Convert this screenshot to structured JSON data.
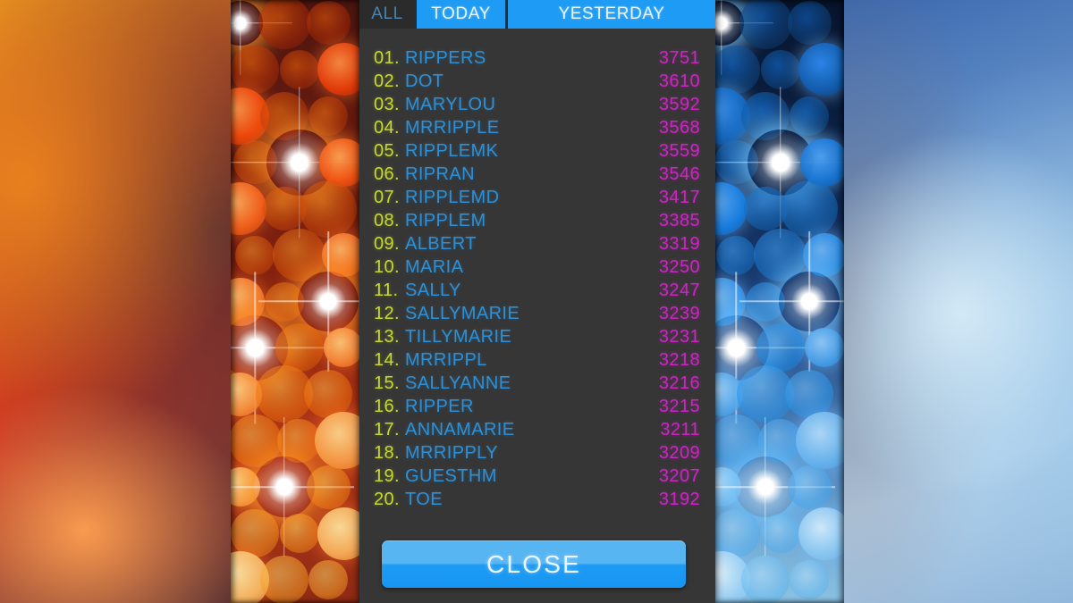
{
  "dialog": {
    "tabs": [
      {
        "label": "ALL",
        "state": "inactive"
      },
      {
        "label": "TODAY",
        "state": "active"
      },
      {
        "label": "YESTERDAY",
        "state": "active"
      }
    ],
    "close_label": "CLOSE"
  },
  "colors": {
    "panel_bg": "#363636",
    "tab_active_bg": "#1d9bf5",
    "tab_inactive_text": "#4c84ad",
    "rank_text": "#c8d92c",
    "name_text": "#2f8fd4",
    "score_text": "#cc25c4",
    "close_button": "#1d9bf5"
  },
  "scoreboard": [
    {
      "rank": "01.",
      "name": "RIPPERS",
      "score": "3751"
    },
    {
      "rank": "02.",
      "name": "DOT",
      "score": "3610"
    },
    {
      "rank": "03.",
      "name": "MARYLOU",
      "score": "3592"
    },
    {
      "rank": "04.",
      "name": "MRRIPPLE",
      "score": "3568"
    },
    {
      "rank": "05.",
      "name": "RIPPLEMK",
      "score": "3559"
    },
    {
      "rank": "06.",
      "name": "RIPRAN",
      "score": "3546"
    },
    {
      "rank": "07.",
      "name": "RIPPLEMD",
      "score": "3417"
    },
    {
      "rank": "08.",
      "name": "RIPPLEM",
      "score": "3385"
    },
    {
      "rank": "09.",
      "name": "ALBERT",
      "score": "3319"
    },
    {
      "rank": "10.",
      "name": "MARIA",
      "score": "3250"
    },
    {
      "rank": "11.",
      "name": "SALLY",
      "score": "3247"
    },
    {
      "rank": "12.",
      "name": "SALLYMARIE",
      "score": "3239"
    },
    {
      "rank": "13.",
      "name": "TILLYMARIE",
      "score": "3231"
    },
    {
      "rank": "14.",
      "name": "MRRIPPL",
      "score": "3218"
    },
    {
      "rank": "15.",
      "name": "SALLYANNE",
      "score": "3216"
    },
    {
      "rank": "16.",
      "name": "RIPPER",
      "score": "3215"
    },
    {
      "rank": "17.",
      "name": "ANNAMARIE",
      "score": "3211"
    },
    {
      "rank": "18.",
      "name": "MRRIPPLY",
      "score": "3209"
    },
    {
      "rank": "19.",
      "name": "GUESTHM",
      "score": "3207"
    },
    {
      "rank": "20.",
      "name": "TOE",
      "score": "3192"
    }
  ]
}
